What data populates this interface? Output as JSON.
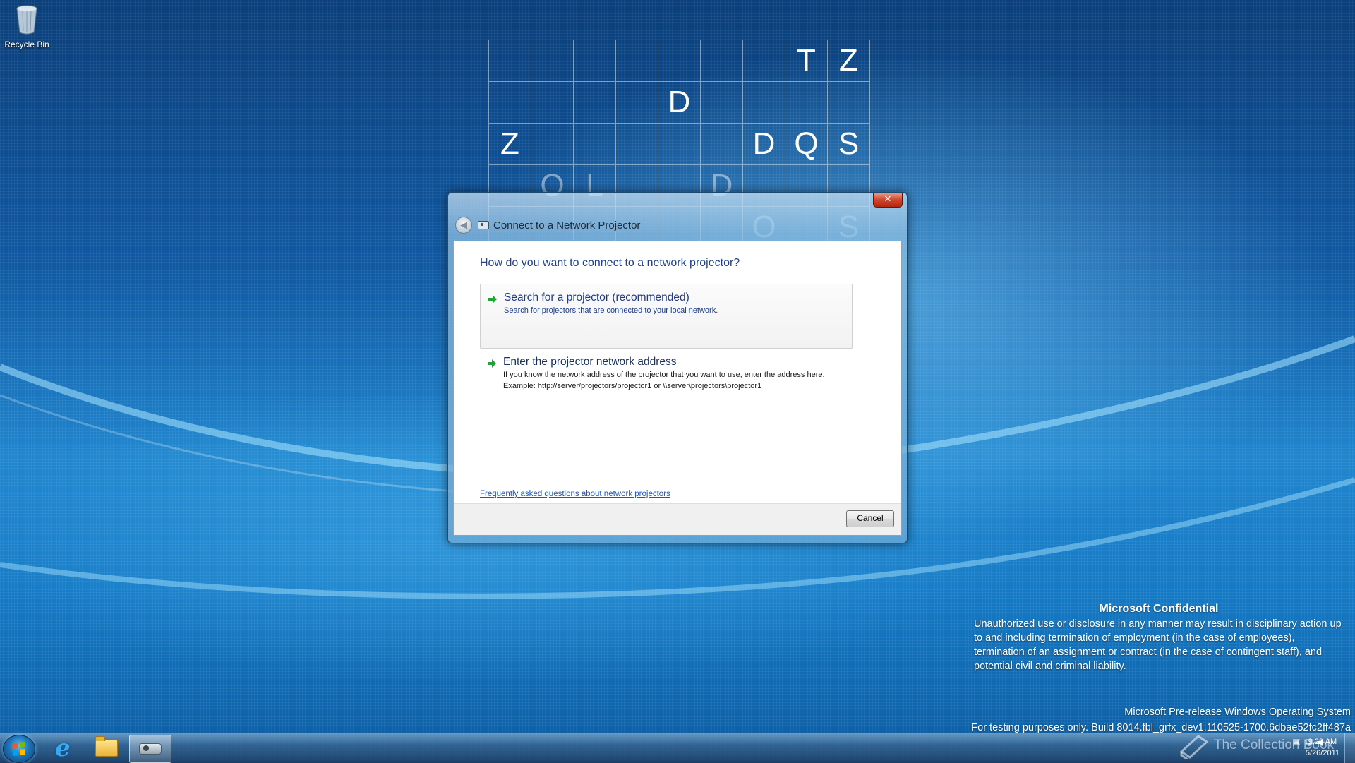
{
  "desktop": {
    "recycle_bin_label": "Recycle Bin"
  },
  "letter_grid": {
    "rows": [
      [
        "",
        "",
        "",
        "",
        "",
        "",
        "",
        "T",
        "Z"
      ],
      [
        "",
        "",
        "",
        "",
        "D",
        "",
        "",
        "",
        ""
      ],
      [
        "Z",
        "",
        "",
        "",
        "",
        "",
        "D",
        "Q",
        "S"
      ],
      [
        "",
        "O",
        "L",
        "",
        "",
        "D",
        "",
        "",
        ""
      ],
      [
        "",
        "",
        "",
        "",
        "",
        "",
        "O",
        "",
        "S"
      ]
    ]
  },
  "dialog": {
    "title": "Connect to a Network Projector",
    "close_label": "✕",
    "question": "How do you want to connect to a network projector?",
    "options": [
      {
        "title": "Search for a projector (recommended)",
        "description": "Search for projectors that are connected to your local network."
      },
      {
        "title": "Enter the projector network address",
        "description": "If you know the network address of the projector that you want to use, enter the address here.",
        "example": "Example: http://server/projectors/projector1 or \\\\server\\projectors\\projector1"
      }
    ],
    "faq_link": "Frequently asked questions about network projectors",
    "cancel_label": "Cancel"
  },
  "confidential": {
    "title": "Microsoft Confidential",
    "text": "Unauthorized use or disclosure in any manner may result in disciplinary action up to and including termination of employment (in the case of employees), termination of an assignment or contract (in the case of contingent staff), and potential civil and criminal liability."
  },
  "prerelease": {
    "line1": "Microsoft Pre-release Windows Operating System",
    "line2": "For testing purposes only. Build 8014.fbl_grfx_dev1.110525-1700.6dbae52fc2ff487a"
  },
  "taskbar": {
    "time": "9:29 AM",
    "date": "5/26/2011",
    "watermark": "The Collection Book",
    "icons": [
      "start-orb",
      "internet-explorer-icon",
      "file-explorer-icon",
      "network-projector-icon"
    ]
  },
  "colors": {
    "link": "#1f55c2",
    "heading": "#1f3f8c",
    "arrow": "#22a33a"
  }
}
